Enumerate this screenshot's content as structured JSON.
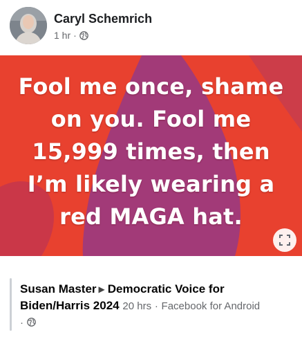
{
  "post": {
    "author": "Caryl Schemrich",
    "time": "1 hr",
    "separator": "·",
    "audience_icon": "globe-icon"
  },
  "meme": {
    "lines": [
      "Fool me once, shame",
      "on you. Fool me",
      "15,999 times, then",
      "I’m likely wearing a",
      "red MAGA hat."
    ],
    "bg_color": "#e8412f",
    "shape_color": "#a23a78",
    "expand_icon": "expand-icon"
  },
  "shared_from": {
    "author": "Susan Master",
    "arrow": "▶",
    "target": "Democratic Voice for Biden/Harris 2024",
    "time": "20 hrs",
    "sep": "·",
    "app": "Facebook for Android",
    "sep2": "·",
    "audience_icon": "globe-icon"
  }
}
